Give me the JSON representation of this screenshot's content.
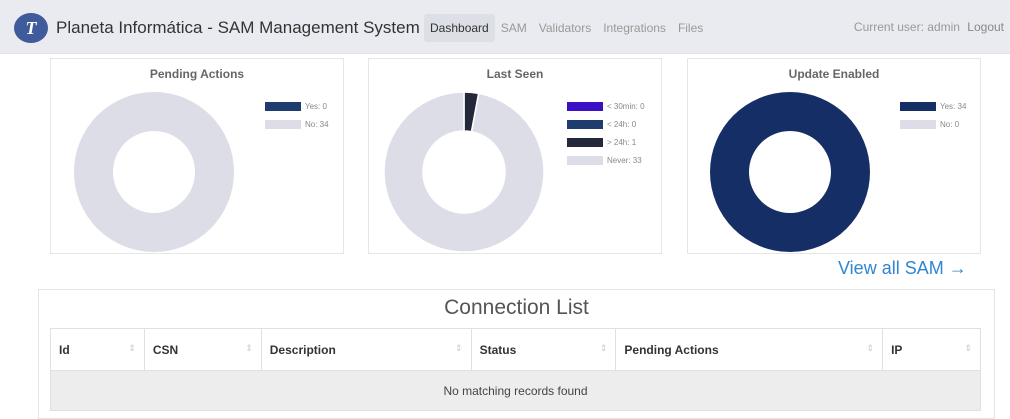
{
  "app": {
    "brand_title": "Planeta Informática - SAM Management System",
    "logo_mark": "T"
  },
  "nav": {
    "items": [
      {
        "label": "Dashboard",
        "active": true
      },
      {
        "label": "SAM"
      },
      {
        "label": "Validators"
      },
      {
        "label": "Integrations"
      },
      {
        "label": "Files"
      }
    ]
  },
  "user": {
    "current_label": "Current user: admin",
    "logout_label": "Logout"
  },
  "cards": {
    "pending_actions": {
      "title": "Pending Actions",
      "legend": [
        {
          "label": "Yes: 0",
          "value": 0,
          "color": "#1f3c6e"
        },
        {
          "label": "No: 34",
          "value": 34,
          "color": "#dcdde6"
        }
      ]
    },
    "last_seen": {
      "title": "Last Seen",
      "legend": [
        {
          "label": "< 30min: 0",
          "value": 0,
          "color": "#3b10c4"
        },
        {
          "label": "< 24h: 0",
          "value": 0,
          "color": "#1f3c6e"
        },
        {
          "label": "> 24h: 1",
          "value": 1,
          "color": "#25273a"
        },
        {
          "label": "Never: 33",
          "value": 33,
          "color": "#dcdde6"
        }
      ]
    },
    "update_enabled": {
      "title": "Update Enabled",
      "legend": [
        {
          "label": "Yes: 34",
          "value": 34,
          "color": "#152f66"
        },
        {
          "label": "No: 0",
          "value": 0,
          "color": "#dcdde6"
        }
      ]
    }
  },
  "view_all_label": "View all SAM →",
  "connection_list": {
    "title": "Connection List",
    "columns": [
      "Id",
      "CSN",
      "Description",
      "Status",
      "Pending Actions",
      "IP"
    ],
    "sort_glyph": "⇕",
    "empty_message": "No matching records found"
  }
}
